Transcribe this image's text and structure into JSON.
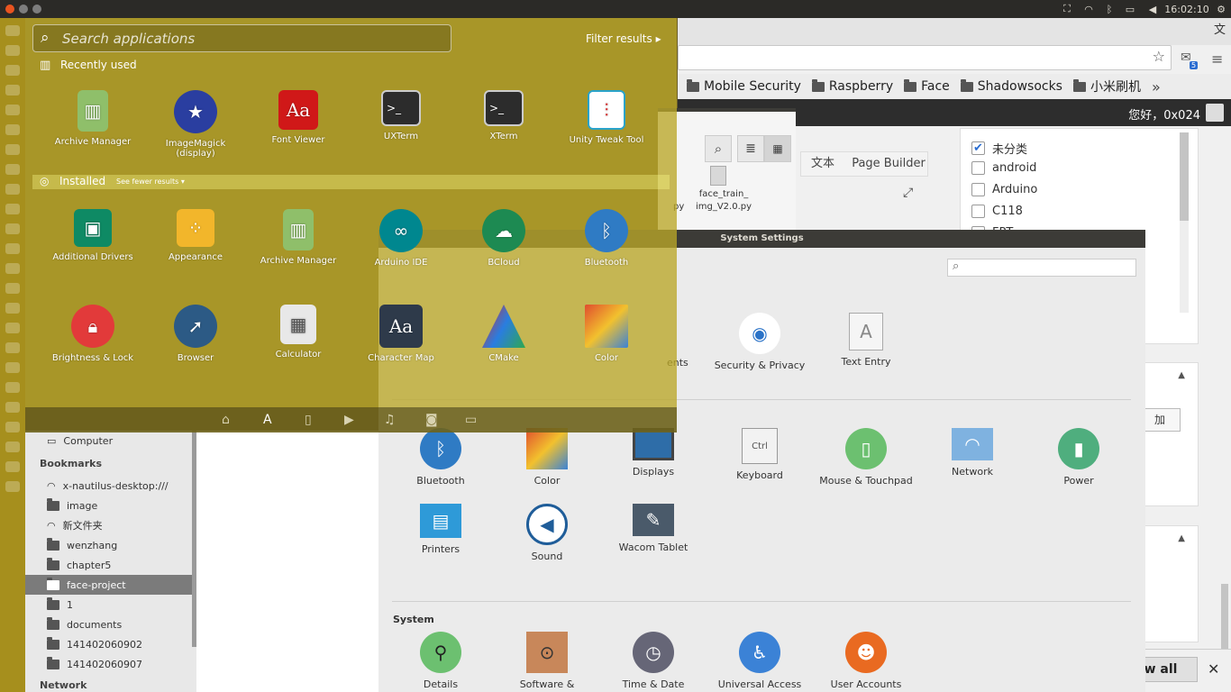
{
  "top_panel": {
    "clock": "16:02:10"
  },
  "dash": {
    "search_placeholder": "Search applications",
    "filter_label": "Filter results",
    "recently_used_label": "Recently used",
    "installed_label": "Installed",
    "see_fewer": "See fewer results",
    "recent_apps": [
      "Archive Manager",
      "ImageMagick (display)",
      "Font Viewer",
      "UXTerm",
      "XTerm",
      "Unity Tweak Tool"
    ],
    "installed_row1": [
      "Additional Drivers",
      "Appearance",
      "Archive Manager",
      "Arduino IDE",
      "BCloud",
      "Bluetooth"
    ],
    "installed_row2": [
      "Brightness & Lock",
      "Browser",
      "Calculator",
      "Character Map",
      "CMake",
      "Color"
    ]
  },
  "browser": {
    "bookmarks": [
      "Mobile Security",
      "Raspberry",
      "Face",
      "Shadowsocks",
      "小米刷机"
    ],
    "greeting": "您好，0x024",
    "ext_badge": "5",
    "tabs": [
      "文本",
      "Page Builder"
    ],
    "categories": [
      {
        "label": "未分类",
        "checked": true
      },
      {
        "label": "android",
        "checked": false
      },
      {
        "label": "Arduino",
        "checked": false
      },
      {
        "label": "C118",
        "checked": false
      },
      {
        "label": "FPT",
        "checked": false
      }
    ],
    "add_button": "加",
    "show_all": "ow all",
    "ime": "文"
  },
  "files_window": {
    "file_name_1": "face_train_",
    "file_name_2": "img_V2.0.py",
    "fragment": "py"
  },
  "system_settings": {
    "title": "System Settings",
    "personal_partial": "ents",
    "personal": [
      "Security & Privacy",
      "Text Entry"
    ],
    "hardware": [
      "Bluetooth",
      "Color",
      "Displays",
      "Keyboard",
      "Mouse & Touchpad",
      "Network",
      "Power",
      "Printers",
      "Sound",
      "Wacom Tablet"
    ],
    "system_label": "System",
    "system": [
      "Details",
      "Software &",
      "Time & Date",
      "Universal Access",
      "User Accounts"
    ]
  },
  "nautilus": {
    "computer": "Computer",
    "bookmarks_label": "Bookmarks",
    "items": [
      "x-nautilus-desktop:///",
      "image",
      "新文件夹",
      "wenzhang",
      "chapter5",
      "face-project",
      "1",
      "documents",
      "141402060902",
      "141402060907"
    ],
    "network_label": "Network"
  },
  "colors": {
    "dash_tint": "#baa628",
    "launcher": "#a68f1d",
    "panel": "#2b2a27"
  }
}
